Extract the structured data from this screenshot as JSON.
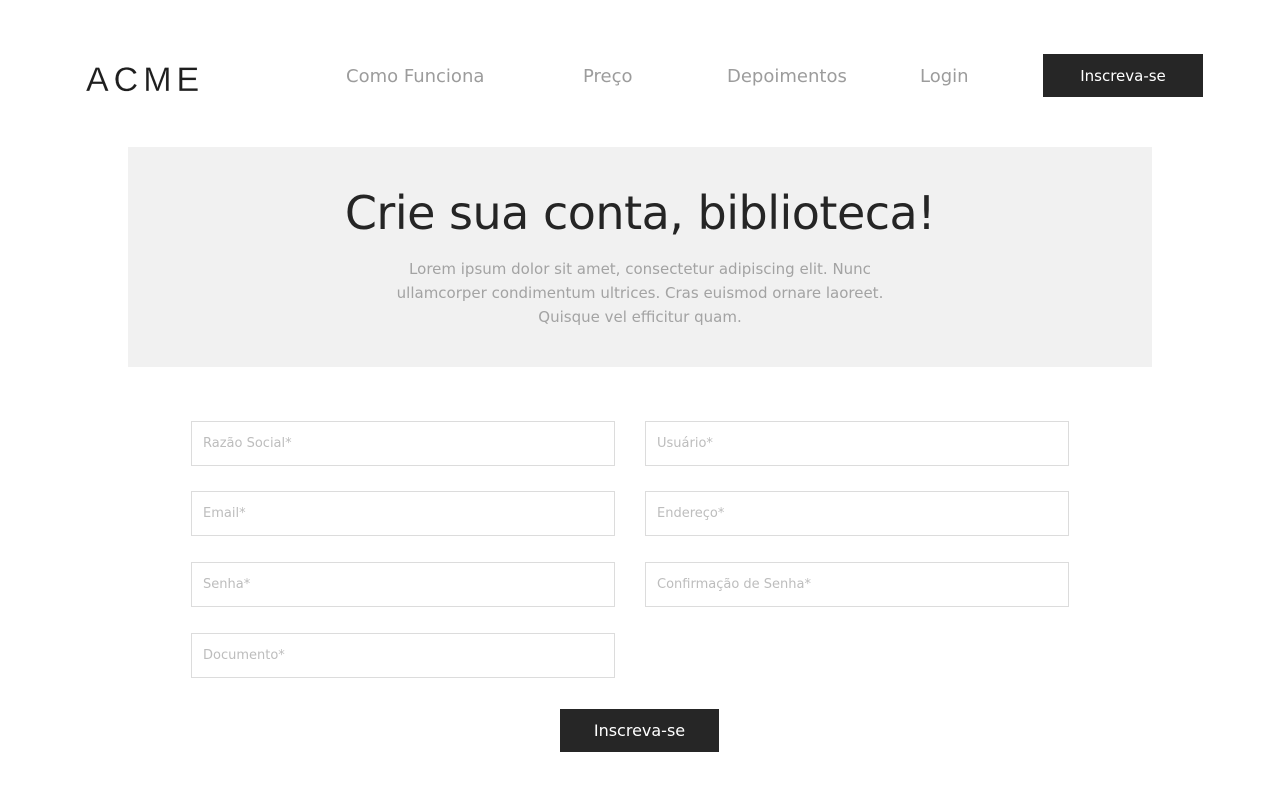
{
  "header": {
    "logo": "ACME",
    "nav": [
      {
        "label": "Como Funciona"
      },
      {
        "label": "Preço"
      },
      {
        "label": "Depoimentos"
      },
      {
        "label": "Login"
      }
    ],
    "cta_label": "Inscreva-se"
  },
  "hero": {
    "title": "Crie sua conta, biblioteca!",
    "text": "Lorem ipsum dolor sit amet, consectetur adipiscing elit. Nunc ullamcorper condimentum ultrices. Cras euismod ornare laoreet. Quisque vel efficitur quam."
  },
  "form": {
    "razao_social": {
      "placeholder": "Razão Social*",
      "value": ""
    },
    "usuario": {
      "placeholder": "Usuário*",
      "value": ""
    },
    "email": {
      "placeholder": "Email*",
      "value": ""
    },
    "endereco": {
      "placeholder": "Endereço*",
      "value": ""
    },
    "senha": {
      "placeholder": "Senha*",
      "value": ""
    },
    "confirmacao_senha": {
      "placeholder": "Confirmação de Senha*",
      "value": ""
    },
    "documento": {
      "placeholder": "Documento*",
      "value": ""
    },
    "submit_label": "Inscreva-se"
  },
  "colors": {
    "background": "#ffffff",
    "hero_background": "#f1f1f1",
    "button_background": "#262626",
    "button_text": "#ffffff",
    "nav_text": "#9c9c9c",
    "title_text": "#252525",
    "body_text": "#a3a3a3",
    "input_border": "#dcdcdc"
  }
}
